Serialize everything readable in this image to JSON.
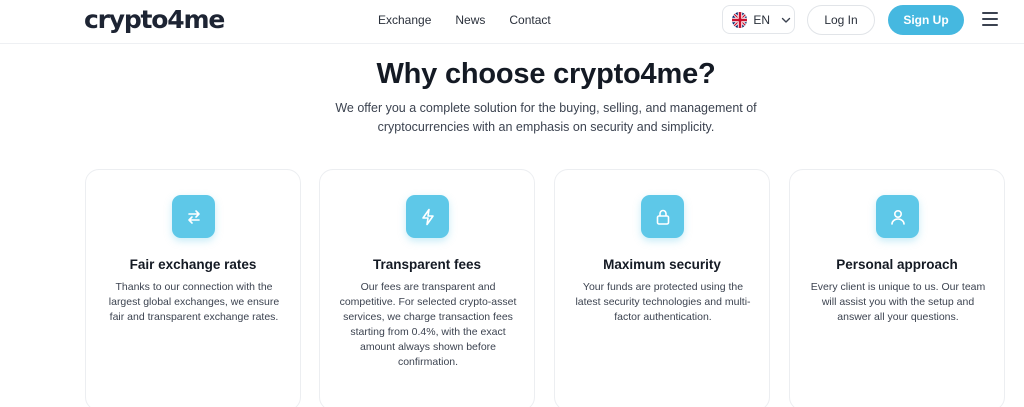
{
  "header": {
    "logo": {
      "part1": "crypto",
      "part2": "4",
      "part3": "me"
    },
    "nav": [
      "Exchange",
      "News",
      "Contact"
    ],
    "language": "EN",
    "login_label": "Log In",
    "signup_label": "Sign Up"
  },
  "hero": {
    "title": "Why choose crypto4me?",
    "subtitle": "We offer you a complete solution for the buying, selling, and management of cryptocurrencies with an emphasis on security and simplicity."
  },
  "features": [
    {
      "icon": "exchange-arrows-icon",
      "title": "Fair exchange rates",
      "text": "Thanks to our connection with the largest global exchanges, we ensure fair and transparent exchange rates."
    },
    {
      "icon": "lightning-bolt-icon",
      "title": "Transparent fees",
      "text": "Our fees are transparent and competitive. For selected crypto-asset services, we charge transaction fees starting from 0.4%, with the exact amount always shown before confirmation."
    },
    {
      "icon": "lock-icon",
      "title": "Maximum security",
      "text": "Your funds are protected using the latest security technologies and multi-factor authentication."
    },
    {
      "icon": "user-icon",
      "title": "Personal approach",
      "text": "Every client is unique to us. Our team will assist you with the setup and answer all your questions."
    }
  ],
  "colors": {
    "accent": "#45b8e0",
    "icon_bg": "#5ec8e8",
    "text_dark": "#141a24"
  }
}
